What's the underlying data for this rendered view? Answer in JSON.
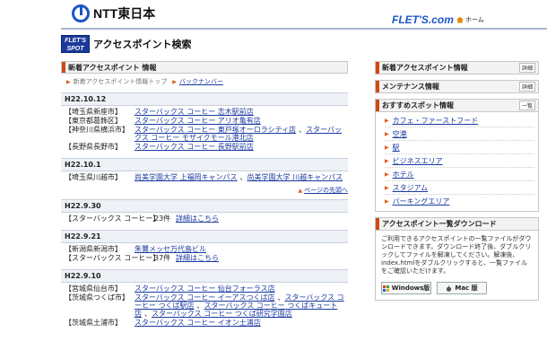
{
  "header": {
    "logo_text": "NTT東日本",
    "brand": "FLET'S.com",
    "home_label": "ホーム"
  },
  "title_area": {
    "badge_top": "FLET'S",
    "badge_bottom": "SPOT",
    "page_title": "アクセスポイント検索"
  },
  "main": {
    "section_title": "新着アクセスポイント 情報",
    "crumb_top": "新着アクセスポイント情報トップ",
    "crumb_back": "バックナンバー",
    "back_to_top": "ページの先頭へ",
    "blocks": [
      {
        "date": "H22.10.12",
        "rows": [
          {
            "pref": "【埼玉県新座市】",
            "links": [
              "スターバックス コーヒー 志木駅前店"
            ]
          },
          {
            "pref": "【東京都葛飾区】",
            "links": [
              "スターバックス コーヒー アリオ亀有店"
            ]
          },
          {
            "pref": "【神奈川県横浜市】",
            "links": [
              "スターバックス コーヒー 東戸塚オーロラシティ店",
              "スターバックス コーヒー モザイクモール港北店"
            ]
          },
          {
            "pref": "【長野県長野市】",
            "links": [
              "スターバックス コーヒー 長野駅前店"
            ]
          }
        ]
      },
      {
        "date": "H22.10.1",
        "rows": [
          {
            "pref": "【埼玉県川越市】",
            "links": [
              "尚美学園大学 上福岡キャンパス",
              "尚美学園大学 川越キャンパス"
            ]
          }
        ]
      },
      {
        "date": "H22.9.30",
        "rows": [
          {
            "pref": "【スターバックス コーヒー】",
            "count": "23件",
            "links": [
              "詳細はこちら"
            ]
          }
        ]
      },
      {
        "date": "H22.9.21",
        "rows": [
          {
            "pref": "【新潟県新潟市】",
            "links": [
              "朱鷺メッセ万代島ビル"
            ]
          },
          {
            "pref": "【スターバックス コーヒー】",
            "count": "37件",
            "links": [
              "詳細はこちら"
            ]
          }
        ]
      },
      {
        "date": "H22.9.10",
        "rows": [
          {
            "pref": "【宮城県仙台市】",
            "links": [
              "スターバックス コーヒー 仙台フォーラス店"
            ]
          },
          {
            "pref": "【茨城県つくば市】",
            "links": [
              "スターバックス コーヒー イーアスつくば店",
              "スターバックス コーヒー つくば駅店",
              "スターバックス コーヒー つくばキュート店",
              "スターバックス コーヒー つくば研究学園店"
            ]
          },
          {
            "pref": "【茨城県土浦市】",
            "links": [
              "スターバックス コーヒー イオン土浦店"
            ]
          }
        ]
      }
    ]
  },
  "sidebar": {
    "news": {
      "label": "新着アクセスポイント情報",
      "more": "詳細"
    },
    "maintenance": {
      "label": "メンテナンス情報",
      "more": "詳細"
    },
    "recommend": {
      "label": "おすすめスポット情報",
      "more": "一覧",
      "items": [
        "カフェ・ファーストフード",
        "空港",
        "駅",
        "ビジネスエリア",
        "ホテル",
        "スタジアム",
        "パーキングエリア"
      ]
    },
    "download": {
      "label": "アクセスポイント一覧ダウンロード",
      "text": "ご利用できるアクセスポイントの一覧ファイルがダウンロードできます。ダウンロード終了後、ダブルクリックしてファイルを解凍してください。解凍後、index.htmlをダブルクリックすると、一覧ファイルをご確認いただけます。",
      "windows": "Windows版",
      "mac": "Mac 版"
    }
  },
  "colors": {
    "accent": "#d24a10",
    "brand_blue": "#1b55c8",
    "link": "#1a3aa0"
  }
}
